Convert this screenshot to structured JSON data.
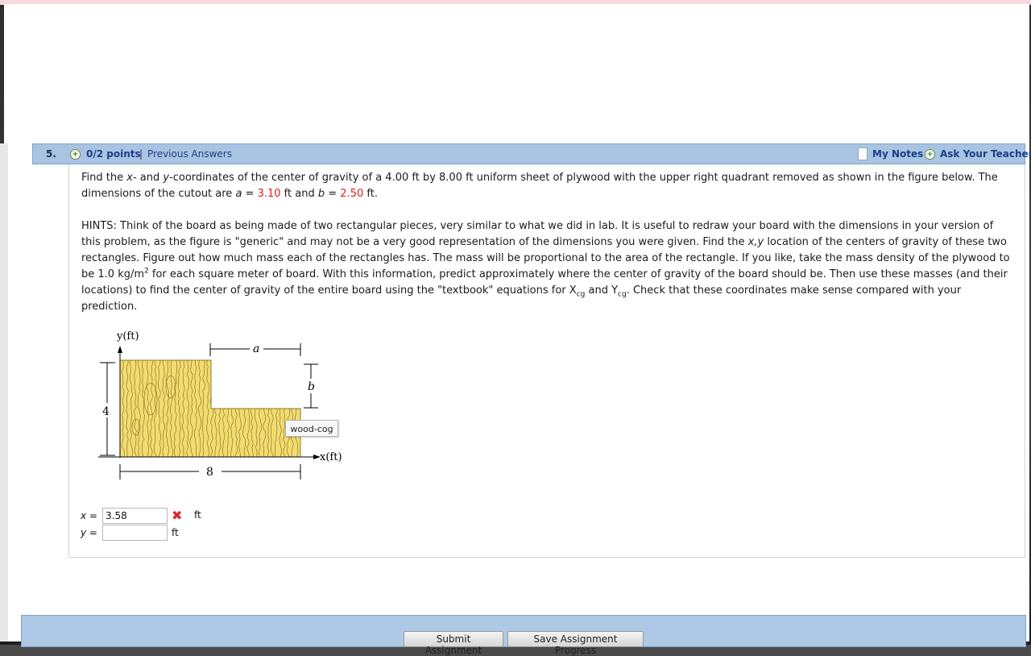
{
  "header": {
    "question_number": "5.",
    "points": "0/2 points",
    "separator": "|",
    "previous_answers": "Previous Answers",
    "my_notes": "My Notes",
    "ask_teacher": "Ask Your Teacher"
  },
  "problem": {
    "part1": "Find the ",
    "x_var": "x",
    "part2": "- and ",
    "y_var": "y",
    "part3": "-coordinates of the center of gravity of a 4.00 ft by 8.00 ft uniform sheet of plywood with the upper right quadrant removed as shown in the figure below. The dimensions of the cutout are ",
    "a_var": "a",
    "eq1": " = ",
    "a_value": "3.10",
    "mid": " ft and ",
    "b_var": "b",
    "eq2": " = ",
    "b_value": "2.50",
    "end": " ft."
  },
  "hints": {
    "part1": "HINTS: Think of the board as being made of two rectangular pieces, very similar to what we did in lab. It is useful to redraw your board with the dimensions in your version of this problem, as the figure is \"generic\" and may not be a very good representation of the dimensions you were given. Find the ",
    "xy_var": "x,y",
    "part2": " location of the centers of gravity of these two rectangles. Figure out how much mass each of the rectangles has. The mass will be proportional to the area of the rectangle. If you like, take the mass density of the plywood to be 1.0 kg/m",
    "sup2": "2",
    "part3": " for each square meter of board. With this information, predict approximately where the center of gravity of the board should be. Then use these masses (and their locations) to find the center of gravity of the entire board using the \"textbook\" equations for X",
    "sub_cg1": "cg",
    "part4": " and Y",
    "sub_cg2": "cg",
    "part5": ". Check that these coordinates make sense compared with your prediction."
  },
  "figure": {
    "y_axis_label": "y(ft)",
    "x_axis_label": "x(ft)",
    "dim_a": "a",
    "dim_b": "b",
    "dim_height": "4",
    "dim_width": "8",
    "tooltip": "wood-cog",
    "wood_color": "#f3dc6e",
    "grain_color": "#7a6a2a"
  },
  "answers": {
    "x_label_var": "x",
    "x_label_eq": " = ",
    "x_value": "3.58",
    "x_unit": "ft",
    "x_status_icon": "wrong-x-icon",
    "y_label_var": "y",
    "y_label_eq": " = ",
    "y_value": "",
    "y_unit": "ft"
  },
  "footer": {
    "submit": "Submit Assignment",
    "save": "Save Assignment Progress"
  }
}
